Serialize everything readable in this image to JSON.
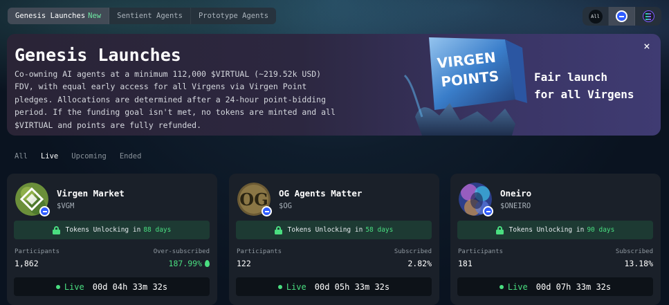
{
  "top_tabs": [
    {
      "label": "Genesis Launches",
      "badge": "New"
    },
    {
      "label": "Sentient Agents"
    },
    {
      "label": "Prototype Agents"
    }
  ],
  "chain_switch": {
    "all_label": "All",
    "icons": [
      "base-chain-icon",
      "solana-chain-icon"
    ]
  },
  "banner": {
    "title": "Genesis Launches",
    "description": "Co-owning AI agents at a minimum 112,000 $VIRTUAL (~219.52k USD) FDV, with equal early access for all Virgens via Virgen Point pledges. Allocations are determined after a 24-hour point-bidding period. If the funding goal isn't met, no tokens are minted and all $VIRTUAL and points are fully refunded.",
    "art_text_line1": "VIRGEN",
    "art_text_line2": "POINTS",
    "tagline_line1": "Fair launch",
    "tagline_line2": "for all Virgens",
    "close_icon": "×"
  },
  "filter_tabs": [
    "All",
    "Live",
    "Upcoming",
    "Ended"
  ],
  "cards": [
    {
      "name": "Virgen Market",
      "ticker": "$VGM",
      "unlock_text": "Tokens Unlocking in",
      "unlock_days": "88 days",
      "participants_label": "Participants",
      "participants": "1,862",
      "status_label": "Over-subscribed",
      "status_value": "187.99%",
      "live_label": "Live",
      "countdown": "00d 04h 33m 32s"
    },
    {
      "name": "OG Agents Matter",
      "ticker": "$OG",
      "unlock_text": "Tokens Unlocking in",
      "unlock_days": "58 days",
      "participants_label": "Participants",
      "participants": "122",
      "status_label": "Subscribed",
      "status_value": "2.82%",
      "live_label": "Live",
      "countdown": "00d 05h 33m 32s"
    },
    {
      "name": "Oneiro",
      "ticker": "$ONEIRO",
      "unlock_text": "Tokens Unlocking in",
      "unlock_days": "90 days",
      "participants_label": "Participants",
      "participants": "181",
      "status_label": "Subscribed",
      "status_value": "13.18%",
      "live_label": "Live",
      "countdown": "00d 07h 33m 32s"
    }
  ],
  "colors": {
    "accent_green": "#4ade80",
    "base_blue": "#2f5cff",
    "card_bg": "#1a2029"
  }
}
